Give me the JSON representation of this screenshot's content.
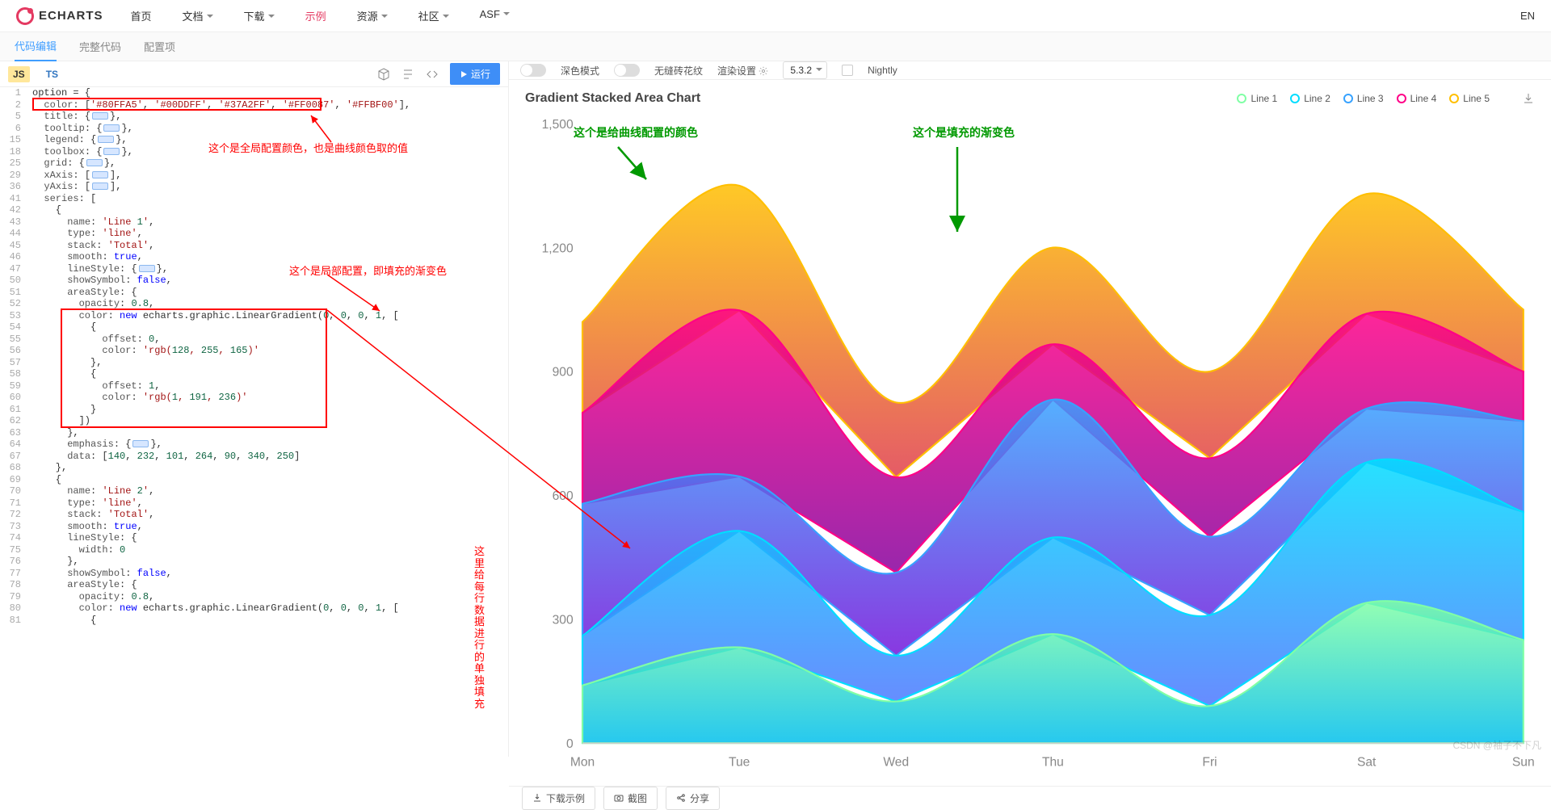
{
  "brand": "ECHARTS",
  "nav": {
    "items": [
      "首页",
      "文档",
      "下载",
      "示例",
      "资源",
      "社区",
      "ASF"
    ],
    "active_index": 3,
    "lang": "EN"
  },
  "subtabs": {
    "items": [
      "代码编辑",
      "完整代码",
      "配置项"
    ],
    "active_index": 0
  },
  "editor": {
    "lang_tabs": {
      "js": "JS",
      "ts": "TS"
    },
    "run_label": "运行"
  },
  "line_numbers": [
    "1",
    "2",
    "5",
    "6",
    "15",
    "18",
    "25",
    "29",
    "36",
    "41",
    "42",
    "43",
    "44",
    "45",
    "46",
    "47",
    "50",
    "51",
    "52",
    "53",
    "54",
    "55",
    "56",
    "57",
    "58",
    "59",
    "60",
    "61",
    "62",
    "63",
    "64",
    "67",
    "68",
    "69",
    "70",
    "71",
    "72",
    "73",
    "74",
    "75",
    "76",
    "77",
    "78",
    "79",
    "80",
    "81"
  ],
  "code_lines": [
    "option = {",
    "  color: ['#80FFA5', '#00DDFF', '#37A2FF', '#FF0087', '#FFBF00'],",
    "  title: {[FOLD]},",
    "  tooltip: {[FOLD]},",
    "  legend: {[FOLD]},",
    "  toolbox: {[FOLD]},",
    "  grid: {[FOLD]},",
    "  xAxis: [[FOLD]],",
    "  yAxis: [[FOLD]],",
    "  series: [",
    "    {",
    "      name: 'Line 1',",
    "      type: 'line',",
    "      stack: 'Total',",
    "      smooth: true,",
    "      lineStyle: {[FOLD]},",
    "      showSymbol: false,",
    "      areaStyle: {",
    "        opacity: 0.8,",
    "        color: new echarts.graphic.LinearGradient(0, 0, 0, 1, [",
    "          {",
    "            offset: 0,",
    "            color: 'rgb(128, 255, 165)'",
    "          },",
    "          {",
    "            offset: 1,",
    "            color: 'rgb(1, 191, 236)'",
    "          }",
    "        ])",
    "      },",
    "      emphasis: {[FOLD]},",
    "      data: [140, 232, 101, 264, 90, 340, 250]",
    "    },",
    "    {",
    "      name: 'Line 2',",
    "      type: 'line',",
    "      stack: 'Total',",
    "      smooth: true,",
    "      lineStyle: {",
    "        width: 0",
    "      },",
    "      showSymbol: false,",
    "      areaStyle: {",
    "        opacity: 0.8,",
    "        color: new echarts.graphic.LinearGradient(0, 0, 0, 1, [",
    "          {"
  ],
  "annotations": {
    "global": "这个是全局配置颜色，也是曲线颜色取的值",
    "local": "这个是局部配置，即填充的渐变色",
    "perrow": "这里给每行数据进行的单独填充",
    "curve_color": "这个是给曲线配置的颜色",
    "fill_color": "这个是填充的渐变色"
  },
  "right_toolbar": {
    "dark_mode": "深色模式",
    "pattern": "无缝砖花纹",
    "render_label": "渲染设置",
    "version": "5.3.2",
    "nightly": "Nightly"
  },
  "chart_data": {
    "type": "area",
    "title": "Gradient Stacked Area Chart",
    "categories": [
      "Mon",
      "Tue",
      "Wed",
      "Thu",
      "Fri",
      "Sat",
      "Sun"
    ],
    "ylim": [
      0,
      1500
    ],
    "yticks": [
      0,
      300,
      600,
      900,
      1200,
      1500
    ],
    "series": [
      {
        "name": "Line 1",
        "color": "#80FFA5",
        "grad_top": "rgb(128,255,165)",
        "grad_bot": "rgb(1,191,236)",
        "values": [
          140,
          232,
          101,
          264,
          90,
          340,
          250
        ]
      },
      {
        "name": "Line 2",
        "color": "#00DDFF",
        "grad_top": "rgb(0,221,255)",
        "grad_bot": "rgb(77,119,255)",
        "values": [
          120,
          282,
          111,
          234,
          220,
          340,
          310
        ]
      },
      {
        "name": "Line 3",
        "color": "#37A2FF",
        "grad_top": "rgb(55,162,255)",
        "grad_bot": "rgb(116,21,219)",
        "values": [
          320,
          132,
          201,
          334,
          190,
          130,
          220
        ]
      },
      {
        "name": "Line 4",
        "color": "#FF0087",
        "grad_top": "rgb(255,0,135)",
        "grad_bot": "rgb(135,0,157)",
        "values": [
          220,
          402,
          231,
          134,
          190,
          230,
          120
        ]
      },
      {
        "name": "Line 5",
        "color": "#FFBF00",
        "grad_top": "rgb(255,191,0)",
        "grad_bot": "rgb(224,62,76)",
        "values": [
          220,
          302,
          181,
          234,
          210,
          290,
          150
        ]
      }
    ]
  },
  "bottom_actions": {
    "download": "下载示例",
    "screenshot": "截图",
    "share": "分享"
  },
  "watermark": "CSDN @袖子不下凡"
}
